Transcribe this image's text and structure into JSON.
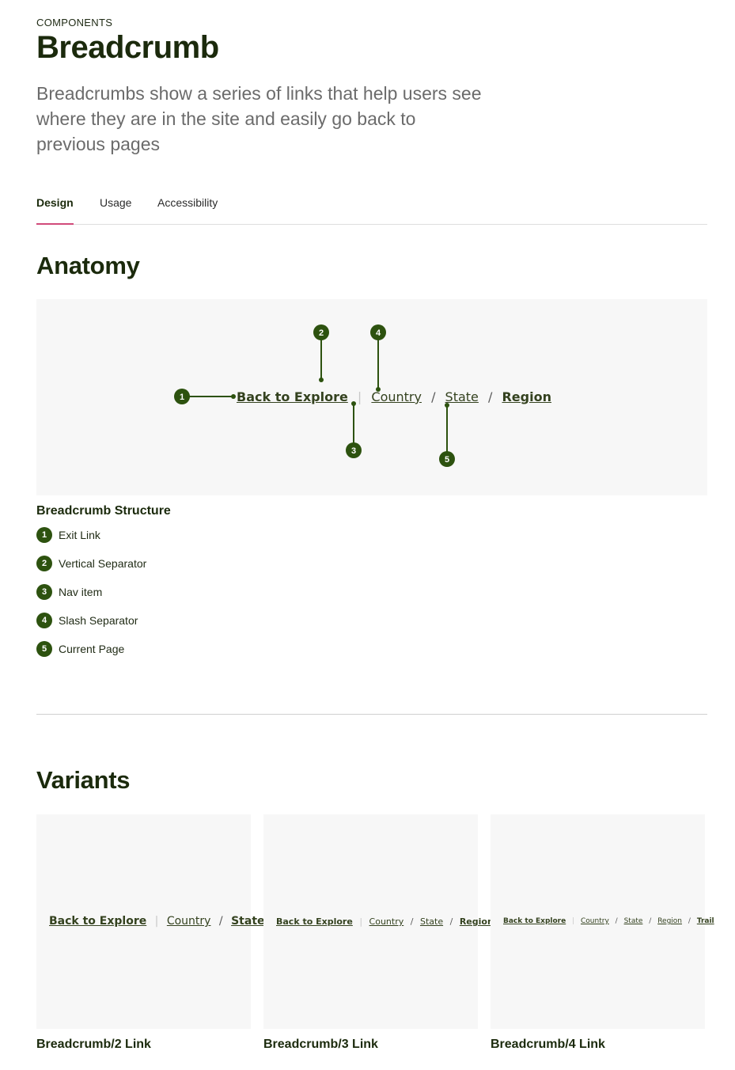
{
  "header": {
    "eyebrow": "COMPONENTS",
    "title": "Breadcrumb",
    "intro": "Breadcrumbs show a series of links that help users see where they are in the site and easily go back to previous pages"
  },
  "tabs": [
    {
      "label": "Design",
      "active": true
    },
    {
      "label": "Usage",
      "active": false
    },
    {
      "label": "Accessibility",
      "active": false
    }
  ],
  "anatomy": {
    "heading": "Anatomy",
    "breadcrumb": {
      "exit": "Back to Explore",
      "vsep": "|",
      "items": [
        "Country",
        "State"
      ],
      "ssep": "/",
      "current": "Region"
    },
    "markers": [
      "1",
      "2",
      "3",
      "4",
      "5"
    ],
    "structure_title": "Breadcrumb Structure",
    "structure": [
      {
        "num": "1",
        "label": "Exit Link"
      },
      {
        "num": "2",
        "label": "Vertical Separator"
      },
      {
        "num": "3",
        "label": "Nav item"
      },
      {
        "num": "4",
        "label": "Slash Separator"
      },
      {
        "num": "5",
        "label": "Current Page"
      }
    ]
  },
  "variants": {
    "heading": "Variants",
    "cards": [
      {
        "label": "Breadcrumb/2 Link",
        "exit": "Back to Explore",
        "items": [
          "Country"
        ],
        "current": "State"
      },
      {
        "label": "Breadcrumb/3 Link",
        "exit": "Back to Explore",
        "items": [
          "Country",
          "State"
        ],
        "current": "Region"
      },
      {
        "label": "Breadcrumb/4 Link",
        "exit": "Back to Explore",
        "items": [
          "Country",
          "State",
          "Region"
        ],
        "current": "Trail"
      }
    ]
  },
  "colors": {
    "accent": "#d14a7a",
    "marker": "#2d520f",
    "text_dark": "#1b2a0c"
  }
}
